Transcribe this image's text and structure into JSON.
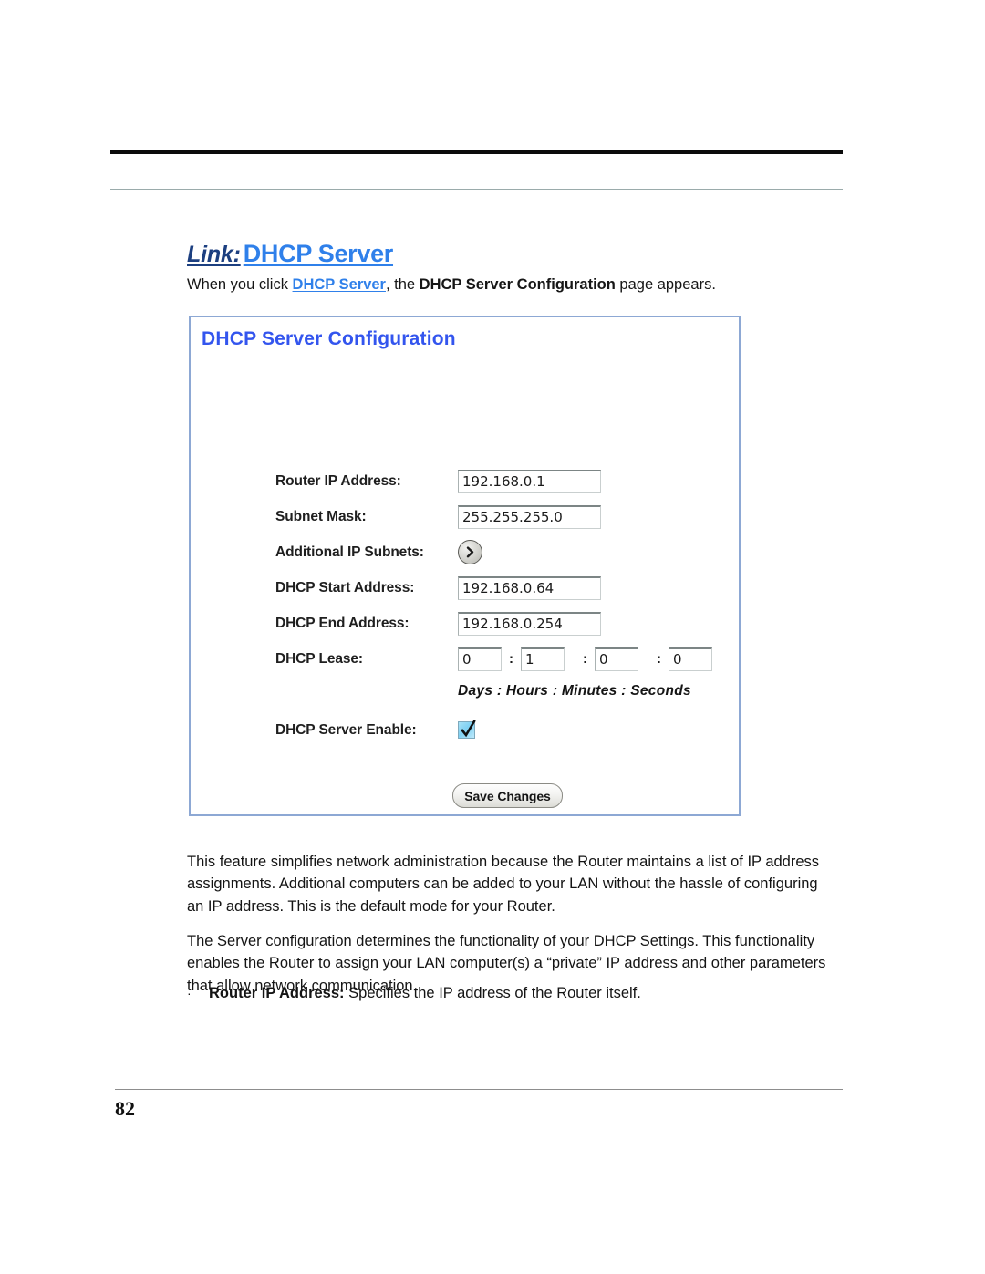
{
  "page": {
    "number": "82"
  },
  "heading": {
    "link_label": "Link:",
    "title": "DHCP Server"
  },
  "intro": {
    "before": "When you click ",
    "link": "DHCP Server",
    "middle": ", the ",
    "bold": "DHCP Server Configuration",
    "after": " page appears."
  },
  "panel": {
    "title": "DHCP Server Configuration",
    "fields": [
      {
        "label": "Router IP Address:",
        "value": "192.168.0.1",
        "type": "text"
      },
      {
        "label": "Subnet Mask:",
        "value": "255.255.255.0",
        "type": "text"
      },
      {
        "label": "Additional IP Subnets:",
        "value": "",
        "type": "arrow-button"
      },
      {
        "label": "DHCP Start Address:",
        "value": "192.168.0.64",
        "type": "text"
      },
      {
        "label": "DHCP End Address:",
        "value": "192.168.0.254",
        "type": "text"
      }
    ],
    "lease": {
      "label": "DHCP Lease:",
      "days": "0",
      "hours": "1",
      "minutes": "0",
      "seconds": "0",
      "separator": ":",
      "units_caption": "Days  :  Hours  :  Minutes  :  Seconds"
    },
    "enable": {
      "label": "DHCP Server Enable:",
      "checked": "true"
    },
    "save_button": "Save Changes",
    "colors": {
      "panel_title": "#3355ee",
      "panel_border": "#8da8d4",
      "checkbox_fill": "#7fd0f2",
      "arrow_button": "#d2d2cd"
    }
  },
  "body": {
    "paragraph_1": "This feature simplifies network administration because the Router maintains a list of IP address assignments. Additional computers can be added to your LAN without the hassle of configuring an IP address. This is the default mode for your Router.",
    "paragraph_2": "The Server configuration determines the functionality of your DHCP Settings. This functionality enables the Router to assign your LAN computer(s) a “private” IP address and other parameters that allow network communication.",
    "bullet": {
      "marker": "·",
      "term": "Router IP Address:",
      "text": " Specifies the IP address of the Router itself."
    }
  }
}
